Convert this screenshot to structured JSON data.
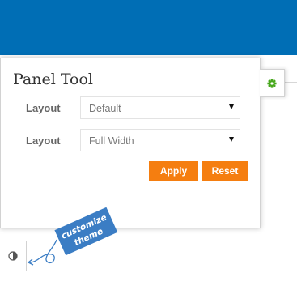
{
  "panel": {
    "title": "Panel Tool",
    "rows": [
      {
        "label": "Layout",
        "value": "Default"
      },
      {
        "label": "Layout",
        "value": "Full Width"
      }
    ],
    "apply_label": "Apply",
    "reset_label": "Reset"
  },
  "annotation": {
    "line1": "customize",
    "line2": "theme"
  },
  "icons": {
    "gear": "gear-icon",
    "theme": "contrast-icon"
  },
  "colors": {
    "header": "#006eb5",
    "button": "#f57e10",
    "annotation": "#3b7dc4",
    "gear": "#48a81e"
  }
}
